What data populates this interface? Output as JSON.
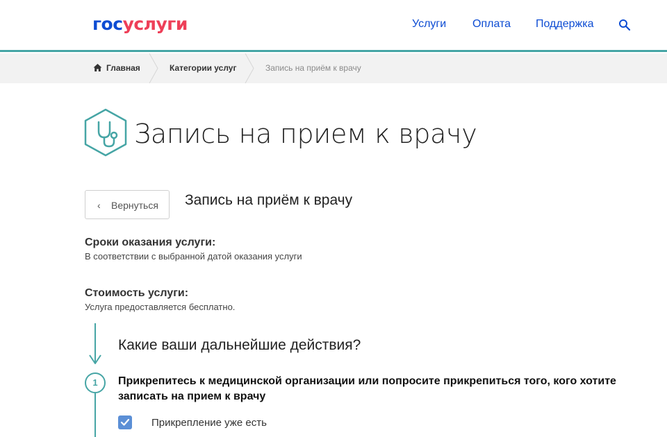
{
  "header": {
    "logo_part1": "гос",
    "logo_part2": "услуги",
    "nav": [
      "Услуги",
      "Оплата",
      "Поддержка"
    ],
    "search_icon": "search-icon",
    "accent_color": "#46a5a5",
    "link_color": "#0d4cd3"
  },
  "breadcrumb": {
    "home": "Главная",
    "categories": "Категории услуг",
    "current": "Запись на приём к врачу"
  },
  "page": {
    "title_icon": "stethoscope-icon",
    "title": "Запись на прием к врачу",
    "back_label": "Вернуться",
    "subtitle": "Запись на приём к врачу"
  },
  "info": {
    "terms_heading": "Сроки оказания услуги:",
    "terms_text": "В соответствии с выбранной датой оказания услуги",
    "cost_heading": "Стоимость услуги:",
    "cost_text": "Услуга предоставляется бесплатно."
  },
  "steps": {
    "next_heading": "Какие ваши дальнейшие действия?",
    "step1_number": "1",
    "step1_text": "Прикрепитесь к медицинской организации или попросите прикрепиться того, кого хотите записать на прием к врачу",
    "checkbox_label": "Прикрепление уже есть",
    "checkbox_checked": true
  }
}
